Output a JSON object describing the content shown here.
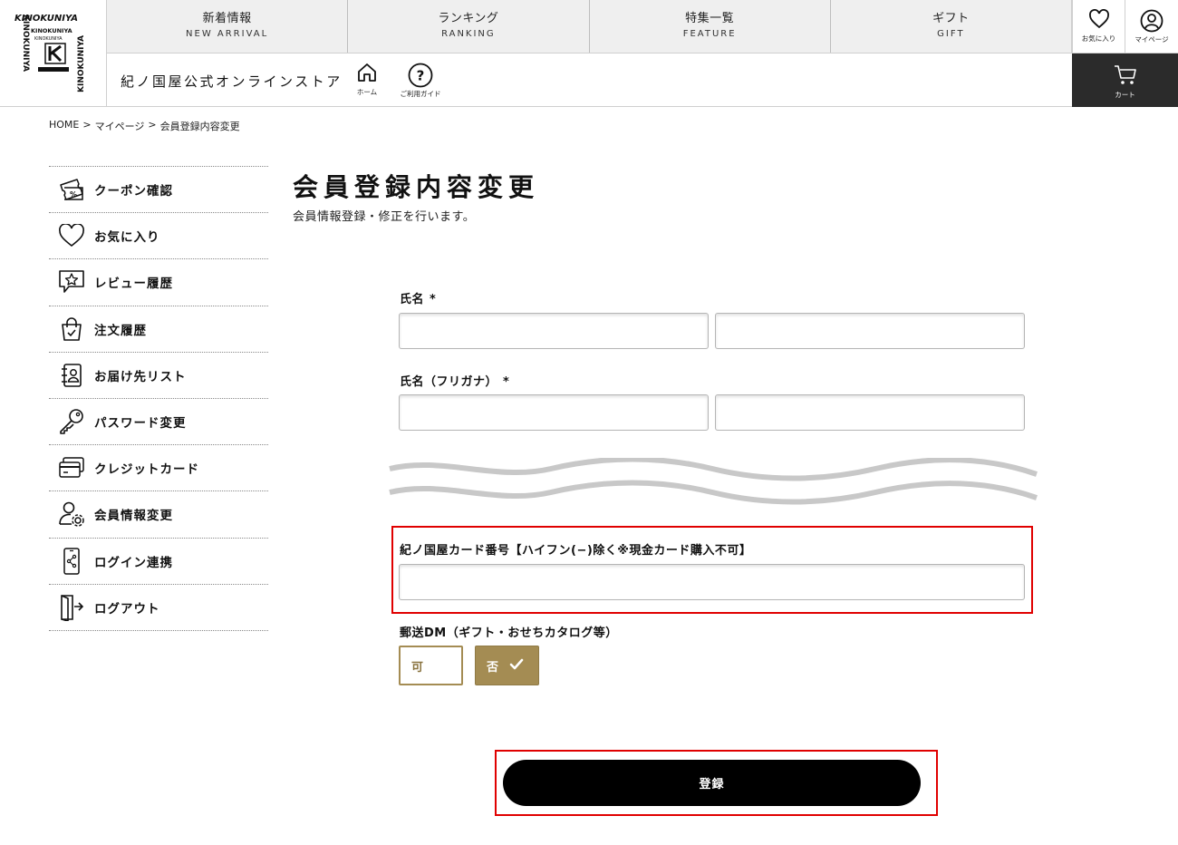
{
  "brand": {
    "logo_text": "KINOKUNIYA",
    "store_name": "紀ノ国屋公式オンラインストア"
  },
  "nav": [
    {
      "jp": "新着情報",
      "en": "NEW ARRIVAL"
    },
    {
      "jp": "ランキング",
      "en": "RANKING"
    },
    {
      "jp": "特集一覧",
      "en": "FEATURE"
    },
    {
      "jp": "ギフト",
      "en": "GIFT"
    }
  ],
  "util": {
    "favorites_label": "お気に入り",
    "mypage_label": "マイページ",
    "home_label": "ホーム",
    "guide_label": "ご利用ガイド",
    "cart_label": "カート"
  },
  "breadcrumb": {
    "home": "HOME",
    "sep1": ">",
    "mypage": "マイページ",
    "sep2": ">",
    "current": "会員登録内容変更"
  },
  "sidebar": {
    "items": [
      {
        "label": "クーポン確認",
        "icon": "coupon-icon"
      },
      {
        "label": "お気に入り",
        "icon": "heart-icon"
      },
      {
        "label": "レビュー履歴",
        "icon": "review-icon"
      },
      {
        "label": "注文履歴",
        "icon": "shopping-bag-icon"
      },
      {
        "label": "お届け先リスト",
        "icon": "address-book-icon"
      },
      {
        "label": "パスワード変更",
        "icon": "key-icon"
      },
      {
        "label": "クレジットカード",
        "icon": "credit-card-icon"
      },
      {
        "label": "会員情報変更",
        "icon": "user-settings-icon"
      },
      {
        "label": "ログイン連携",
        "icon": "phone-share-icon"
      },
      {
        "label": "ログアウト",
        "icon": "logout-icon"
      }
    ]
  },
  "main": {
    "title": "会員登録内容変更",
    "description": "会員情報登録・修正を行います。",
    "name_label": "氏名",
    "name_required": "*",
    "name_sei_value": "",
    "name_mei_value": "",
    "kana_label": "氏名（フリガナ）",
    "kana_required": "*",
    "kana_sei_value": "",
    "kana_mei_value": "",
    "card_label": "紀ノ国屋カード番号【ハイフン(−)除く※現金カード購入不可】",
    "card_value": "",
    "dm_label": "郵送DM（ギフト・おせちカタログ等）",
    "dm_yes": "可",
    "dm_no": "否",
    "dm_selected": "否",
    "submit_label": "登録"
  },
  "colors": {
    "accent_gold": "#a48c53",
    "highlight_red": "#e00000",
    "cart_bg": "#2b2b2b",
    "nav_bg": "#efefef"
  }
}
